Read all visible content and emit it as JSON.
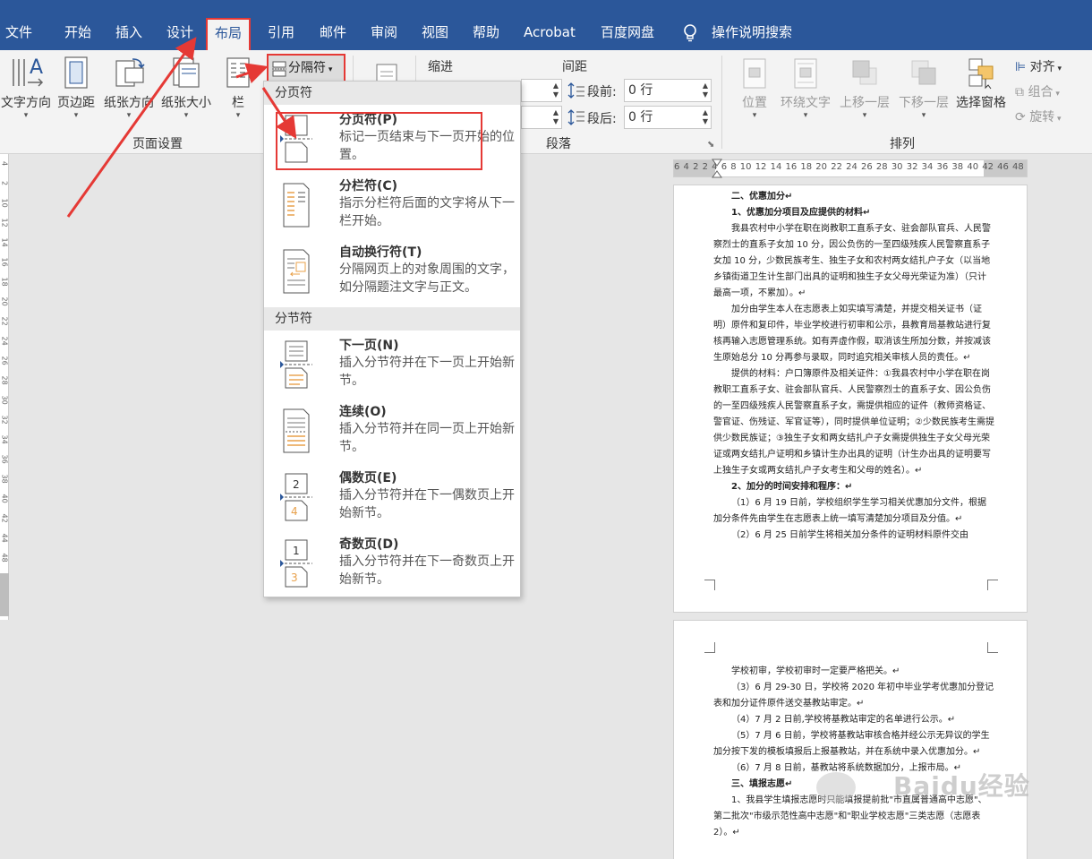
{
  "tabs": [
    "文件",
    "开始",
    "插入",
    "设计",
    "布局",
    "引用",
    "邮件",
    "审阅",
    "视图",
    "帮助",
    "Acrobat",
    "百度网盘",
    "操作说明搜索"
  ],
  "ribbon": {
    "page_setup": {
      "text_direction": "文字方向",
      "margins": "页边距",
      "orientation": "纸张方向",
      "size": "纸张大小",
      "columns": "栏",
      "breaks": "分隔符",
      "group_label": "页面设置"
    },
    "paragraph": {
      "indent_label": "缩进",
      "spacing_label": "间距",
      "before_label": "段前:",
      "before_value": "0 行",
      "after_label": "段后:",
      "after_value": "0 行",
      "group_label": "段落"
    },
    "arrange": {
      "position": "位置",
      "wrap_text": "环绕文字",
      "bring_forward": "上移一层",
      "send_backward": "下移一层",
      "selection_pane": "选择窗格",
      "align": "对齐",
      "group": "组合",
      "rotate": "旋转",
      "group_label": "排列"
    }
  },
  "dropdown": {
    "section_page_breaks": "分页符",
    "section_section_breaks": "分节符",
    "items": [
      {
        "title": "分页符(P)",
        "desc": "标记一页结束与下一页开始的位置。"
      },
      {
        "title": "分栏符(C)",
        "desc": "指示分栏符后面的文字将从下一栏开始。"
      },
      {
        "title": "自动换行符(T)",
        "desc": "分隔网页上的对象周围的文字，如分隔题注文字与正文。"
      },
      {
        "title": "下一页(N)",
        "desc": "插入分节符并在下一页上开始新节。"
      },
      {
        "title": "连续(O)",
        "desc": "插入分节符并在同一页上开始新节。"
      },
      {
        "title": "偶数页(E)",
        "desc": "插入分节符并在下一偶数页上开始新节。"
      },
      {
        "title": "奇数页(D)",
        "desc": "插入分节符并在下一奇数页上开始新节。"
      }
    ]
  },
  "ruler": {
    "numbers": "6 4 2  2 4 6 8 10 12 14 16 18 20 22 24 26 28 30 32 34 36 38 40 42  46 48",
    "left_numbers": [
      "4",
      "2",
      "10",
      "12",
      "14",
      "16",
      "18",
      "20",
      "22",
      "24",
      "26",
      "28",
      "30",
      "32",
      "34",
      "36",
      "38",
      "40",
      "42",
      "44",
      "48"
    ]
  },
  "doc": {
    "page1": [
      {
        "text": "二、优惠加分↵",
        "bold": true,
        "indent": true
      },
      {
        "text": "1、优惠加分项目及应提供的材料↵",
        "bold": true,
        "indent": true
      },
      {
        "text": "我县农村中小学在职在岗教职工直系子女、驻会部队官兵、人民警察烈士的直系子女加 10 分，因公负伤的一至四级残疾人民警察直系子女加 10 分，少数民族考生、独生子女和农村两女结扎户子女（以当地乡镇街道卫生计生部门出具的证明和独生子女父母光荣证为准）（只计最高一项，不累加）。↵",
        "bold": false,
        "indent": true
      },
      {
        "text": "加分由学生本人在志愿表上如实填写清楚，并提交相关证书（证明）原件和复印件，毕业学校进行初审和公示，县教育局基教站进行复核再输入志愿管理系统。如有弄虚作假，取消该生所加分数，并按减该生原始总分 10 分再参与录取，同时追究相关审核人员的责任。↵",
        "bold": false,
        "indent": true
      },
      {
        "text": "提供的材料：户口簿原件及相关证件：①我县农村中小学在职在岗教职工直系子女、驻会部队官兵、人民警察烈士的直系子女、因公负伤的一至四级残疾人民警察直系子女，需提供相应的证件（教师资格证、警官证、伤残证、军官证等），同时提供单位证明；②少数民族考生需提供少数民族证；③独生子女和两女结扎户子女需提供独生子女父母光荣证或两女结扎户证明和乡镇计生办出具的证明（计生办出具的证明要写上独生子女或两女结扎户子女考生和父母的姓名）。↵",
        "bold": false,
        "indent": true
      },
      {
        "text": "2、加分的时间安排和程序：↵",
        "bold": true,
        "indent": true
      },
      {
        "text": "（1）6 月 19 日前，学校组织学生学习相关优惠加分文件，根据加分条件先由学生在志愿表上统一填写清楚加分项目及分值。↵",
        "bold": false,
        "indent": true
      },
      {
        "text": "（2）6 月 25 日前学生将相关加分条件的证明材料原件交由",
        "bold": false,
        "indent": true
      }
    ],
    "page2": [
      {
        "text": "学校初审，学校初审时一定要严格把关。↵",
        "bold": false,
        "indent": true
      },
      {
        "text": "（3）6 月 29-30 日，学校将 2020 年初中毕业学考优惠加分登记表和加分证件原件送交基教站审定。↵",
        "bold": false,
        "indent": true
      },
      {
        "text": "（4）7 月 2 日前,学校将基教站审定的名单进行公示。↵",
        "bold": false,
        "indent": true
      },
      {
        "text": "（5）7 月 6 日前，学校将基教站审核合格并经公示无异议的学生加分按下发的模板填报后上报基教站，并在系统中录入优惠加分。↵",
        "bold": false,
        "indent": true
      },
      {
        "text": "（6）7 月 8 日前，基教站将系统数据加分，上报市局。↵",
        "bold": false,
        "indent": true
      },
      {
        "text": "三、填报志愿↵",
        "bold": true,
        "indent": true
      },
      {
        "text": "1、我县学生填报志愿时只能填报提前批\"市直属普通高中志愿\"、第二批次\"市级示范性高中志愿\"和\"职业学校志愿\"三类志愿（志愿表 2）。↵",
        "bold": false,
        "indent": true
      }
    ]
  },
  "watermark": "Baidu经验",
  "colors": {
    "titlebar": "#2b579a",
    "ribbon": "#f3f3f3",
    "highlight": "#e53935",
    "accent_orange": "#e8a04a"
  }
}
